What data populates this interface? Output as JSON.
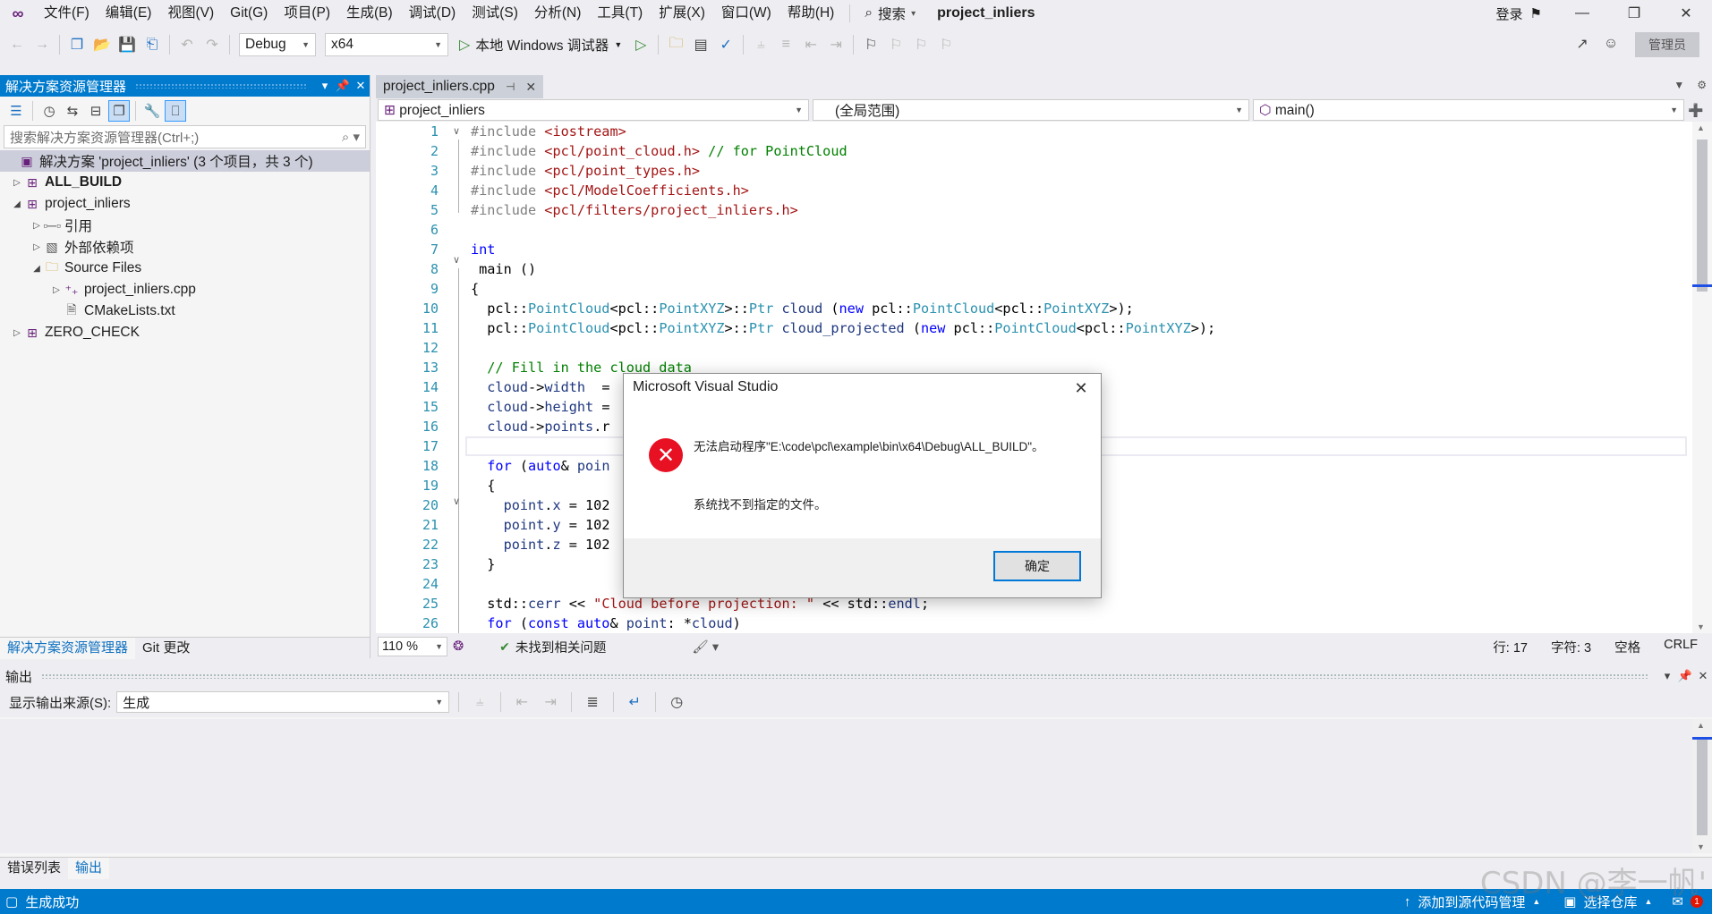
{
  "menubar": {
    "logo": "vs-logo",
    "items": [
      "文件(F)",
      "编辑(E)",
      "视图(V)",
      "Git(G)",
      "项目(P)",
      "生成(B)",
      "调试(D)",
      "测试(S)",
      "分析(N)",
      "工具(T)",
      "扩展(X)",
      "窗口(W)",
      "帮助(H)"
    ],
    "search_label": "搜索",
    "solution_title": "project_inliers",
    "login_label": "登录"
  },
  "toolbar": {
    "config": "Debug",
    "platform": "x64",
    "debugger_label": "本地 Windows 调试器",
    "admin_label": "管理员"
  },
  "solution_explorer": {
    "title": "解决方案资源管理器",
    "search_placeholder": "搜索解决方案资源管理器(Ctrl+;)",
    "tree": [
      {
        "label": "解决方案 'project_inliers' (3 个项目，共 3 个)",
        "icon": "solution-icon"
      },
      {
        "label": "ALL_BUILD",
        "icon": "project-icon"
      },
      {
        "label": "project_inliers",
        "icon": "project-icon"
      },
      {
        "label": "引用",
        "icon": "references-icon"
      },
      {
        "label": "外部依赖项",
        "icon": "external-deps-icon"
      },
      {
        "label": "Source Files",
        "icon": "folder-icon"
      },
      {
        "label": "project_inliers.cpp",
        "icon": "cpp-file-icon"
      },
      {
        "label": "CMakeLists.txt",
        "icon": "text-file-icon"
      },
      {
        "label": "ZERO_CHECK",
        "icon": "project-icon"
      }
    ],
    "tabs": [
      "解决方案资源管理器",
      "Git 更改"
    ]
  },
  "editor": {
    "tab_label": "project_inliers.cpp",
    "nav_project": "project_inliers",
    "nav_scope": "(全局范围)",
    "nav_member": "main()",
    "line_numbers": [
      "1",
      "2",
      "3",
      "4",
      "5",
      "6",
      "7",
      "8",
      "9",
      "10",
      "11",
      "12",
      "13",
      "14",
      "15",
      "16",
      "17",
      "18",
      "19",
      "20",
      "21",
      "22",
      "23",
      "24",
      "25",
      "26"
    ],
    "zoom": "110 %",
    "issues": "未找到相关问题",
    "line_info": "行: 17",
    "char_info": "字符: 3",
    "space_info": "空格",
    "eol_info": "CRLF"
  },
  "output": {
    "title": "输出",
    "source_label": "显示输出来源(S):",
    "source_value": "生成",
    "tabs": [
      "错误列表",
      "输出"
    ]
  },
  "statusbar": {
    "build_status": "生成成功",
    "add_source_control": "添加到源代码管理",
    "select_repo": "选择仓库",
    "notifications": "1",
    "watermark": "CSDN @李一帆'"
  },
  "dialog": {
    "title": "Microsoft Visual Studio",
    "message": "无法启动程序\"E:\\code\\pcl\\example\\bin\\x64\\Debug\\ALL_BUILD\"。",
    "detail": "系统找不到指定的文件。",
    "ok_label": "确定"
  },
  "colors": {
    "accent": "#007acc",
    "error": "#e81123"
  }
}
